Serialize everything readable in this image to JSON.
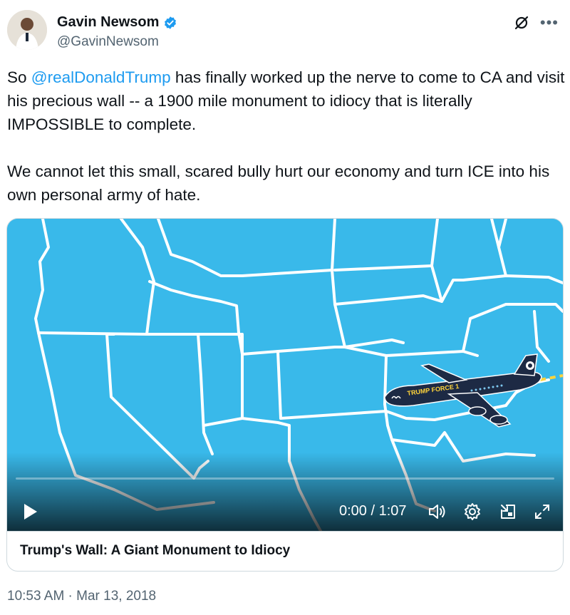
{
  "author": {
    "display_name": "Gavin Newsom",
    "handle": "@GavinNewsom"
  },
  "tweet": {
    "part1": "So ",
    "mention": "@realDonaldTrump",
    "part2": " has finally worked up the nerve to come to CA and visit his precious wall -- a 1900 mile monument to idiocy that is literally IMPOSSIBLE to complete.\n\nWe cannot let this small, scared bully hurt our economy and turn ICE into his own personal army of hate."
  },
  "video": {
    "plane_label": "TRUMP FORCE 1",
    "time": "0:00 / 1:07",
    "progress": 0,
    "caption": "Trump's Wall: A Giant Monument to Idiocy"
  },
  "timestamp": "10:53 AM · Mar 13, 2018",
  "colors": {
    "map_blue": "#39b9ea",
    "link_blue": "#1d9bf0",
    "verified_blue": "#1d9bf0"
  },
  "icons": [
    "verified-badge-icon",
    "grok-icon",
    "more-icon",
    "play-icon",
    "volume-icon",
    "settings-icon",
    "pip-icon",
    "fullscreen-icon"
  ]
}
